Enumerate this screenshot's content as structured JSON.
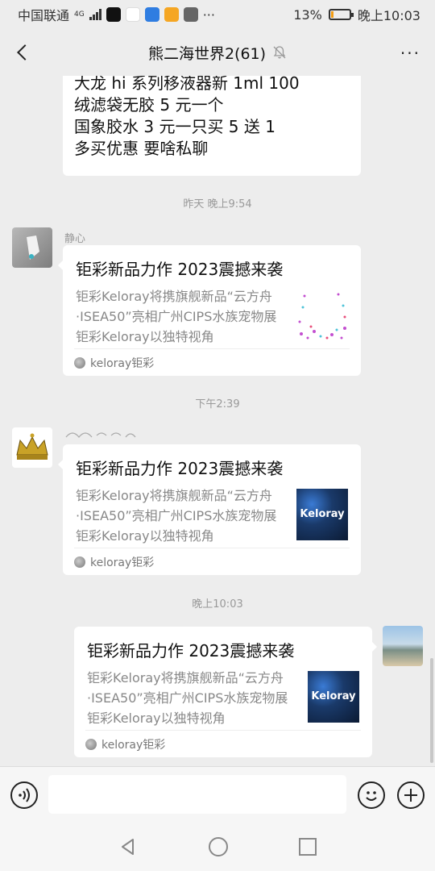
{
  "status_bar": {
    "carrier": "中国联通",
    "network": "4G",
    "more_icons": "···",
    "battery": "13%",
    "time": "晚上10:03",
    "battery_level": 0.13
  },
  "nav": {
    "title": "熊二海世界2(61)",
    "more": "···"
  },
  "first_message": {
    "lines": [
      "大龙 hi 系列移液器新 1ml 100",
      "绒滤袋无胶 5 元一个",
      "国象胶水 3 元一只买 5 送 1",
      "多买优惠   要啥私聊"
    ]
  },
  "timestamps": [
    "昨天 晚上9:54",
    "下午2:39",
    "晚上10:03"
  ],
  "messages": [
    {
      "sender": "静心",
      "card": {
        "title": "钜彩新品力作 2023震撼来袭",
        "desc": [
          "钜彩Keloray将携旗舰新品“云方舟",
          "·ISEA50”亮相广州CIPS水族宠物展",
          "钜彩Keloray以独特视角"
        ],
        "source": "keloray钜彩"
      }
    },
    {
      "sender": "",
      "card": {
        "title": "钜彩新品力作 2023震撼来袭",
        "desc": [
          "钜彩Keloray将携旗舰新品“云方舟",
          "·ISEA50”亮相广州CIPS水族宠物展",
          "钜彩Keloray以独特视角"
        ],
        "source": "keloray钜彩",
        "thumb_text": "Keloray"
      }
    },
    {
      "sender": "",
      "card": {
        "title": "钜彩新品力作 2023震撼来袭",
        "desc": [
          "钜彩Keloray将携旗舰新品“云方舟",
          "·ISEA50”亮相广州CIPS水族宠物展",
          "钜彩Keloray以独特视角"
        ],
        "source": "keloray钜彩",
        "thumb_text": "Keloray"
      }
    }
  ],
  "input": {
    "placeholder": ""
  }
}
